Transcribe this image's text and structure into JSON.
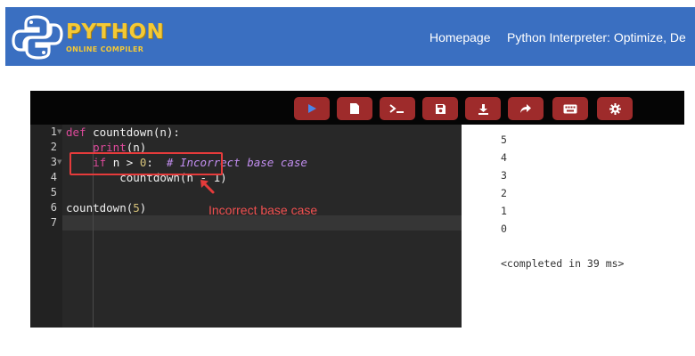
{
  "header": {
    "brand_title": "PYTHON",
    "brand_subtitle": "ONLINE COMPILER",
    "nav_items": [
      "Homepage",
      "Python Interpreter: Optimize, De"
    ],
    "colors": {
      "background": "#3a6fc1",
      "brand": "#f4c935"
    }
  },
  "toolbar": {
    "buttons": [
      "run-icon",
      "new-file-icon",
      "terminal-icon",
      "save-icon",
      "download-icon",
      "share-icon",
      "keyboard-icon",
      "settings-icon"
    ],
    "colors": {
      "bar": "#050505",
      "button": "#9e2b2b"
    }
  },
  "editor": {
    "line_numbers": [
      "1",
      "2",
      "3",
      "4",
      "5",
      "6",
      "7"
    ],
    "lines": [
      {
        "tokens": [
          {
            "t": "def ",
            "c": "kw"
          },
          {
            "t": "countdown(n):",
            "c": "fn"
          }
        ]
      },
      {
        "tokens": [
          {
            "t": "    ",
            "c": "pl"
          },
          {
            "t": "print",
            "c": "kw"
          },
          {
            "t": "(n)",
            "c": "pl"
          }
        ]
      },
      {
        "tokens": [
          {
            "t": "    ",
            "c": "pl"
          },
          {
            "t": "if",
            "c": "kw"
          },
          {
            "t": " n > ",
            "c": "pl"
          },
          {
            "t": "0",
            "c": "num"
          },
          {
            "t": ":  ",
            "c": "pl"
          },
          {
            "t": "# Incorrect base case",
            "c": "cm"
          }
        ]
      },
      {
        "tokens": [
          {
            "t": "        countdown(n - 1)",
            "c": "pl"
          }
        ]
      },
      {
        "tokens": []
      },
      {
        "tokens": [
          {
            "t": "countdown(",
            "c": "pl"
          },
          {
            "t": "5",
            "c": "num"
          },
          {
            "t": ")",
            "c": "pl"
          }
        ]
      },
      {
        "tokens": []
      }
    ],
    "annotation": "Incorrect base case",
    "colors": {
      "keyword": "#dd4a9b",
      "number": "#d7c37a",
      "comment": "#c28ef0",
      "annotation": "#f05050"
    }
  },
  "output": {
    "lines": [
      "5",
      "4",
      "3",
      "2",
      "1",
      "0",
      "",
      "<completed in 39 ms>"
    ]
  }
}
